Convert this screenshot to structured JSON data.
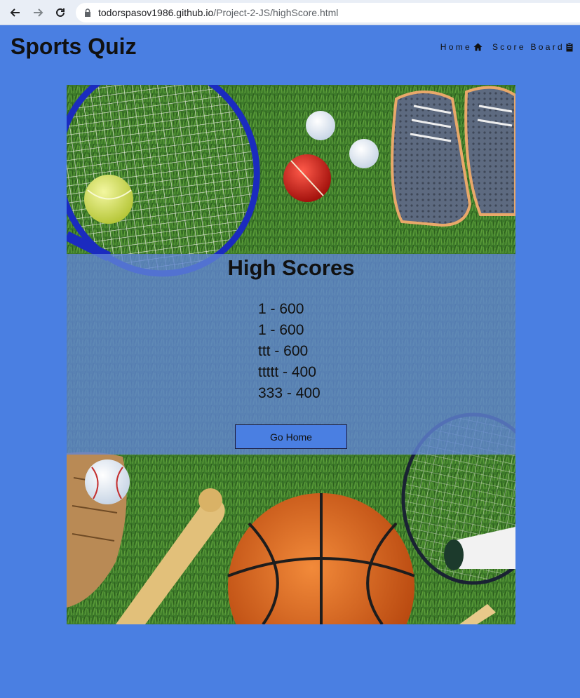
{
  "browser": {
    "url_host": "todorspasov1986.github.io",
    "url_path": "/Project-2-JS/highScore.html"
  },
  "header": {
    "title": "Sports Quiz",
    "nav": [
      {
        "label": "Home",
        "icon": "home-icon"
      },
      {
        "label": "Score Board",
        "icon": "clipboard-icon"
      }
    ]
  },
  "scores": {
    "title": "High Scores",
    "items": [
      "1 - 600",
      "1 - 600",
      "ttt - 600",
      "ttttt - 400",
      "333 - 400"
    ],
    "button_label": "Go Home"
  },
  "colors": {
    "page_background": "#4a7fe2",
    "button_background": "#4a7fe2",
    "panel_overlay": "#6084d6"
  }
}
